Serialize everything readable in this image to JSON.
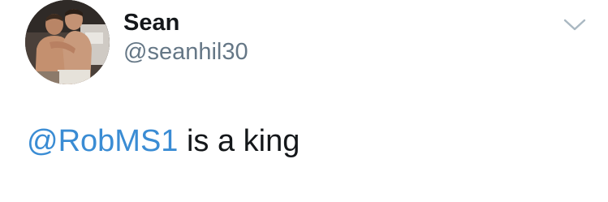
{
  "tweet": {
    "author": {
      "display_name": "Sean",
      "handle": "@seanhil30",
      "avatar_icon": "profile-photo"
    },
    "menu_icon": "chevron-down-icon",
    "text": {
      "mention": "@RobMS1",
      "body": " is a king"
    }
  },
  "colors": {
    "mention": "#3a8cd4",
    "name": "#14171a",
    "handle": "#657786",
    "chevron": "#aab8c2"
  }
}
